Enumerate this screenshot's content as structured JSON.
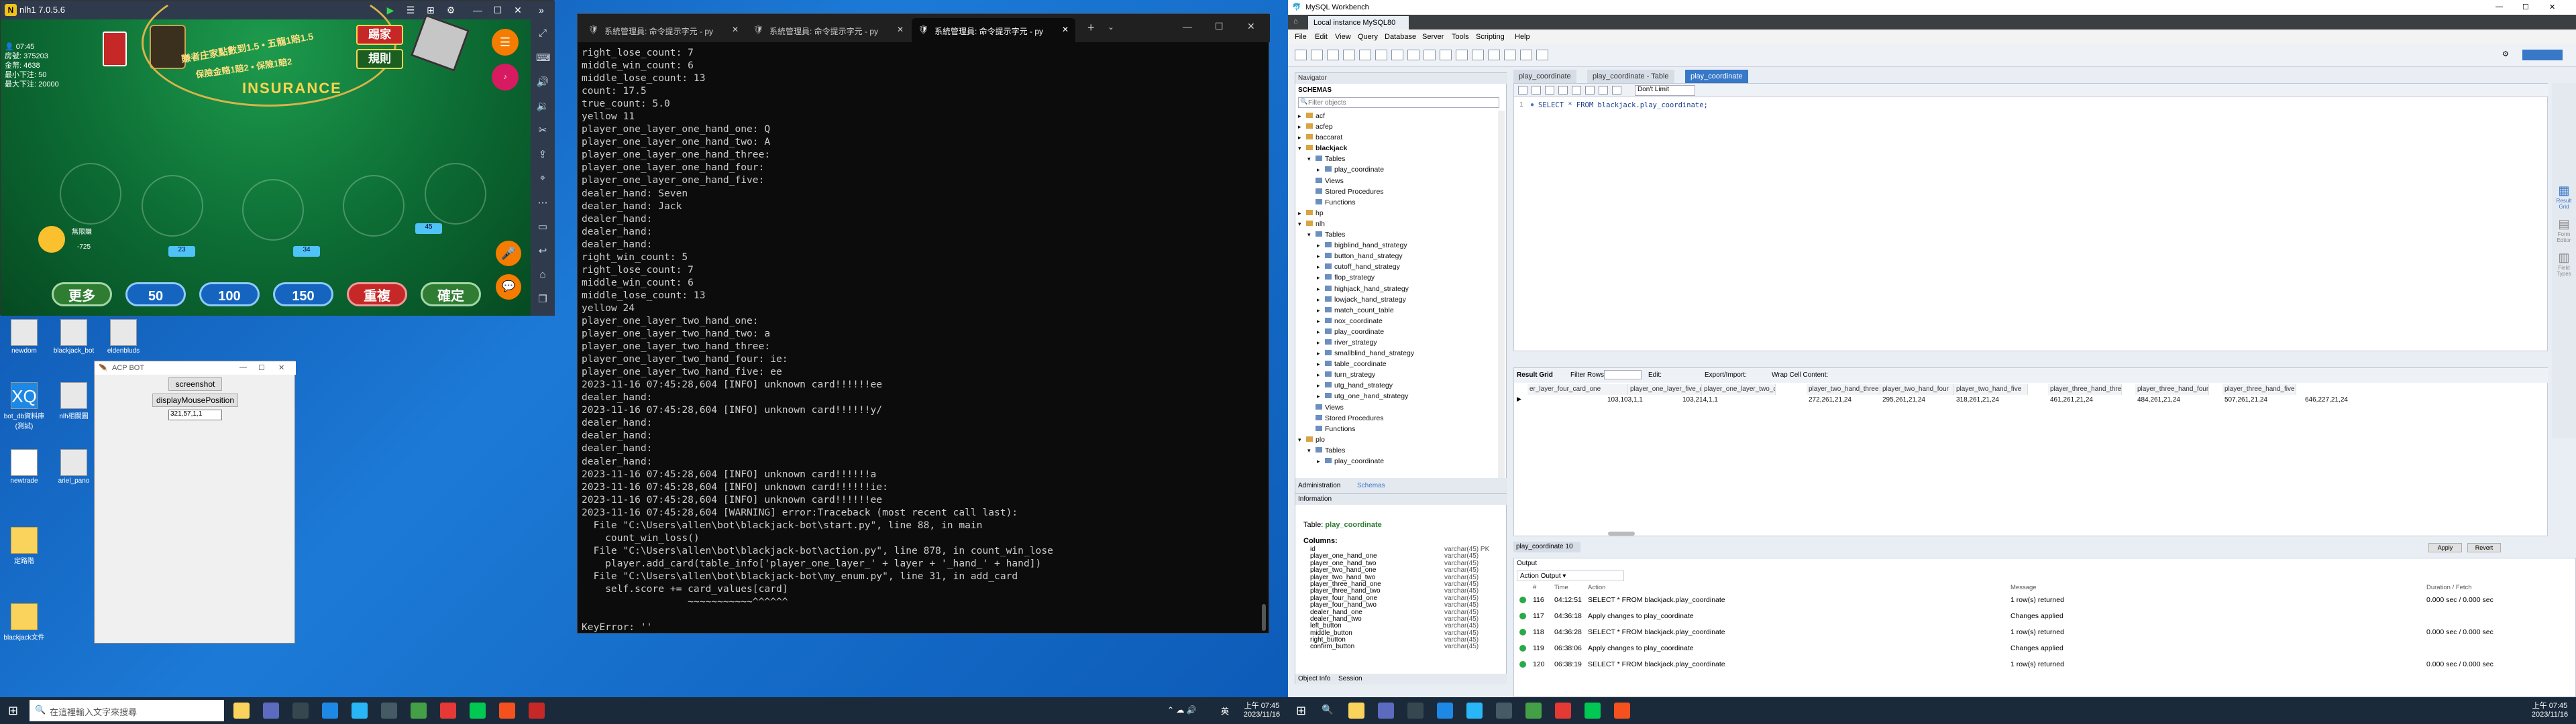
{
  "nox": {
    "title": "nlh1 7.0.5.6",
    "stats": [
      "👤 07:45",
      "房號: 375203",
      "金幣: 4638",
      "最小下注: 50",
      "最大下注: 20000"
    ],
    "insurance": "INSURANCE",
    "felt_line1": "賺者庄家點數到1.5 • 五龍1賠1.5",
    "felt_line2": "保險金赂1賠2 • 保險1賠2",
    "btn_kick": "踢家",
    "btn_rule": "規則",
    "btn_more": "更多",
    "chips": [
      "50",
      "100",
      "150"
    ],
    "btn_repeat": "重複",
    "btn_confirm": "確定",
    "dealer_score": "-725",
    "dealer_name": "無限賺",
    "badges": [
      "23",
      "34",
      "45",
      "56"
    ]
  },
  "desktop_icons": [
    "newdom",
    "blackjack_bot",
    "eldenbluds",
    "bot_db資料庫(測試)",
    "nlh相關圖",
    "newtrade",
    "ariel_pano",
    "定路階",
    "blackjack文件"
  ],
  "acp": {
    "title": "ACP BOT",
    "screenshot": "screenshot",
    "display": "displayMousePosition",
    "coords": "321,57,1,1"
  },
  "terminal": {
    "tabs": [
      "系統管理員: 命令提示字元 - py",
      "系統管理員: 命令提示字元 - py",
      "系統管理員: 命令提示字元 - py"
    ],
    "lines": [
      "right_lose_count: 7",
      "middle_win_count: 6",
      "middle_lose_count: 13",
      "count: 17.5",
      "true_count: 5.0",
      "yellow 11",
      "player_one_layer_one_hand_one: Q",
      "player_one_layer_one_hand_two: A",
      "player_one_layer_one_hand_three:",
      "player_one_layer_one_hand_four:",
      "player_one_layer_one_hand_five:",
      "dealer_hand: Seven",
      "dealer_hand: Jack",
      "dealer_hand:",
      "dealer_hand:",
      "dealer_hand:",
      "right_win_count: 5",
      "right_lose_count: 7",
      "middle_win_count: 6",
      "middle_lose_count: 13",
      "yellow 24",
      "player_one_layer_two_hand_one:",
      "player_one_layer_two_hand_two: a",
      "player_one_layer_two_hand_three:",
      "player_one_layer_two_hand_four: ie:",
      "player_one_layer_two_hand_five: ee",
      "2023-11-16 07:45:28,604 [INFO] unknown card!!!!!!ee",
      "dealer_hand:",
      "2023-11-16 07:45:28,604 [INFO] unknown card!!!!!!y/",
      "dealer_hand:",
      "dealer_hand:",
      "dealer_hand:",
      "dealer_hand:",
      "2023-11-16 07:45:28,604 [INFO] unknown card!!!!!!a",
      "2023-11-16 07:45:28,604 [INFO] unknown card!!!!!!ie:",
      "2023-11-16 07:45:28,604 [INFO] unknown card!!!!!!ee",
      "2023-11-16 07:45:28,604 [WARNING] error:Traceback (most recent call last):",
      "  File \"C:\\Users\\allen\\bot\\blackjack-bot\\start.py\", line 88, in main",
      "    count_win_loss()",
      "  File \"C:\\Users\\allen\\bot\\blackjack-bot\\action.py\", line 878, in count_win_lose",
      "    player.add_card(table_info['player_one_layer_' + layer + '_hand_' + hand])",
      "  File \"C:\\Users\\allen\\bot\\blackjack-bot\\my_enum.py\", line 31, in add_card",
      "    self.score += card_values[card]",
      "                  ~~~~~~~~~~~^^^^^^",
      "",
      "KeyError: ''"
    ]
  },
  "taskbar_left": {
    "search": "在這裡輸入文字來搜尋",
    "time": "上午 07:45",
    "date": "2023/11/16",
    "lang": "英"
  },
  "taskbar_right": {
    "time": "上午 07:45",
    "date": "2023/11/16"
  },
  "workbench": {
    "title": "MySQL Workbench",
    "instance_tab": "Local instance MySQL80",
    "menu": [
      "File",
      "Edit",
      "View",
      "Query",
      "Database",
      "Server",
      "Tools",
      "Scripting",
      "Help"
    ],
    "navigator": "Navigator",
    "schemas_label": "SCHEMAS",
    "filter_placeholder": "Filter objects",
    "tree": [
      {
        "t": "acf",
        "d": 0,
        "e": "▸"
      },
      {
        "t": "acfep",
        "d": 0,
        "e": "▸"
      },
      {
        "t": "baccarat",
        "d": 0,
        "e": "▸"
      },
      {
        "t": "blackjack",
        "d": 0,
        "e": "▾",
        "b": true
      },
      {
        "t": "Tables",
        "d": 1,
        "e": "▾"
      },
      {
        "t": "play_coordinate",
        "d": 2,
        "e": "▸"
      },
      {
        "t": "Views",
        "d": 1,
        "e": ""
      },
      {
        "t": "Stored Procedures",
        "d": 1,
        "e": ""
      },
      {
        "t": "Functions",
        "d": 1,
        "e": ""
      },
      {
        "t": "hp",
        "d": 0,
        "e": "▸"
      },
      {
        "t": "nlh",
        "d": 0,
        "e": "▾"
      },
      {
        "t": "Tables",
        "d": 1,
        "e": "▾"
      },
      {
        "t": "bigblind_hand_strategy",
        "d": 2,
        "e": "▸"
      },
      {
        "t": "button_hand_strategy",
        "d": 2,
        "e": "▸"
      },
      {
        "t": "cutoff_hand_strategy",
        "d": 2,
        "e": "▸"
      },
      {
        "t": "flop_strategy",
        "d": 2,
        "e": "▸"
      },
      {
        "t": "highjack_hand_strategy",
        "d": 2,
        "e": "▸"
      },
      {
        "t": "lowjack_hand_strategy",
        "d": 2,
        "e": "▸"
      },
      {
        "t": "match_count_table",
        "d": 2,
        "e": "▸"
      },
      {
        "t": "nox_coordinate",
        "d": 2,
        "e": "▸"
      },
      {
        "t": "play_coordinate",
        "d": 2,
        "e": "▸"
      },
      {
        "t": "river_strategy",
        "d": 2,
        "e": "▸"
      },
      {
        "t": "smallblind_hand_strategy",
        "d": 2,
        "e": "▸"
      },
      {
        "t": "table_coordinate",
        "d": 2,
        "e": "▸"
      },
      {
        "t": "turn_strategy",
        "d": 2,
        "e": "▸"
      },
      {
        "t": "utg_hand_strategy",
        "d": 2,
        "e": "▸"
      },
      {
        "t": "utg_one_hand_strategy",
        "d": 2,
        "e": "▸"
      },
      {
        "t": "Views",
        "d": 1,
        "e": ""
      },
      {
        "t": "Stored Procedures",
        "d": 1,
        "e": ""
      },
      {
        "t": "Functions",
        "d": 1,
        "e": ""
      },
      {
        "t": "plo",
        "d": 0,
        "e": "▾"
      },
      {
        "t": "Tables",
        "d": 1,
        "e": "▾"
      },
      {
        "t": "play_coordinate",
        "d": 2,
        "e": "▸"
      }
    ],
    "nav_tabs": [
      "Administration",
      "Schemas"
    ],
    "info_label": "Information",
    "info_table_label": "Table:",
    "info_table": "play_coordinate",
    "columns_label": "Columns:",
    "columns": [
      [
        "id",
        "varchar(45) PK"
      ],
      [
        "player_one_hand_one",
        "varchar(45)"
      ],
      [
        "player_one_hand_two",
        "varchar(45)"
      ],
      [
        "player_two_hand_one",
        "varchar(45)"
      ],
      [
        "player_two_hand_two",
        "varchar(45)"
      ],
      [
        "player_three_hand_one",
        "varchar(45)"
      ],
      [
        "player_three_hand_two",
        "varchar(45)"
      ],
      [
        "player_four_hand_one",
        "varchar(45)"
      ],
      [
        "player_four_hand_two",
        "varchar(45)"
      ],
      [
        "dealer_hand_one",
        "varchar(45)"
      ],
      [
        "dealer_hand_two",
        "varchar(45)"
      ],
      [
        "left_button",
        "varchar(45)"
      ],
      [
        "middle_button",
        "varchar(45)"
      ],
      [
        "right_button",
        "varchar(45)"
      ],
      [
        "confirm_button",
        "varchar(45)"
      ]
    ],
    "info_tabs": [
      "Object Info",
      "Session"
    ],
    "editor_tabs": [
      "play_coordinate",
      "play_coordinate - Table",
      "play_coordinate"
    ],
    "line_no": "1",
    "sql": "SELECT * FROM blackjack.play_coordinate;",
    "limit": "Don't Limit",
    "grid_toolbar": [
      "Result Grid",
      "Filter Rows:",
      "Edit:",
      "Export/Import:",
      "Wrap Cell Content:"
    ],
    "grid_headers": [
      "er_layer_four_card_one",
      "player_one_layer_five_card_one",
      "player_one_layer_two_card_one_2",
      "player_two_hand_three",
      "player_two_hand_four",
      "player_two_hand_five",
      "player_three_hand_three",
      "player_three_hand_four",
      "player_three_hand_five"
    ],
    "grid_row": [
      "",
      "103,103,1,1",
      "103,214,1,1",
      "272,261,21,24",
      "295,261,21,24",
      "318,261,21,24",
      "461,261,21,24",
      "484,261,21,24",
      "507,261,21,24",
      "646,227,21,24"
    ],
    "right_panel": [
      "Result Grid",
      "Form Editor",
      "Field Types"
    ],
    "result_tab": "play_coordinate 10",
    "apply": "Apply",
    "revert": "Revert",
    "output_label": "Output",
    "action_output": "Action Output",
    "out_headers": [
      "#",
      "Time",
      "Action",
      "Message",
      "Duration / Fetch"
    ],
    "out_rows": [
      [
        "116",
        "04:12:51",
        "SELECT * FROM blackjack.play_coordinate",
        "1 row(s) returned",
        "0.000 sec / 0.000 sec"
      ],
      [
        "117",
        "04:36:18",
        "Apply changes to play_coordinate",
        "Changes applied",
        ""
      ],
      [
        "118",
        "04:36:28",
        "SELECT * FROM blackjack.play_coordinate",
        "1 row(s) returned",
        "0.000 sec / 0.000 sec"
      ],
      [
        "119",
        "06:38:06",
        "Apply changes to play_coordinate",
        "Changes applied",
        ""
      ],
      [
        "120",
        "06:38:19",
        "SELECT * FROM blackjack.play_coordinate",
        "1 row(s) returned",
        "0.000 sec / 0.000 sec"
      ]
    ]
  }
}
